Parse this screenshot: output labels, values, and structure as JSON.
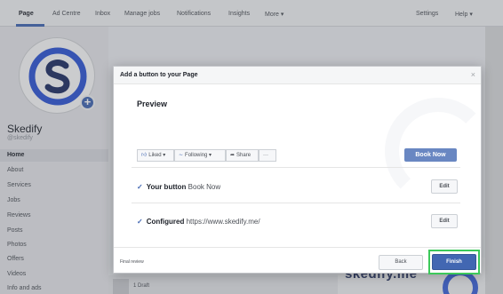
{
  "topnav": {
    "tabs": [
      {
        "label": "Page"
      },
      {
        "label": "Ad Centre"
      },
      {
        "label": "Inbox"
      },
      {
        "label": "Manage jobs"
      },
      {
        "label": "Notifications"
      },
      {
        "label": "Insights"
      },
      {
        "label": "More ▾"
      }
    ],
    "settings": "Settings",
    "help": "Help ▾"
  },
  "page": {
    "name": "Skedify",
    "handle": "@skedify"
  },
  "sidebar": {
    "items": [
      {
        "label": "Home"
      },
      {
        "label": "About"
      },
      {
        "label": "Services"
      },
      {
        "label": "Jobs"
      },
      {
        "label": "Reviews"
      },
      {
        "label": "Posts"
      },
      {
        "label": "Photos"
      },
      {
        "label": "Offers"
      },
      {
        "label": "Videos"
      },
      {
        "label": "Info and ads"
      }
    ]
  },
  "background": {
    "draft_label": "1 Draft",
    "banner_text": "skedify.me"
  },
  "dialog": {
    "title": "Add a button to your Page",
    "close": "×",
    "preview_title": "Preview",
    "preview_buttons": {
      "liked": "Liked ▾",
      "following": "Following ▾",
      "share": "Share",
      "more": "···"
    },
    "cta_label": "Book Now",
    "rows": [
      {
        "bold": "Your button",
        "rest": "Book Now",
        "edit": "Edit"
      },
      {
        "bold": "Configured",
        "rest": "https://www.skedify.me/",
        "edit": "Edit"
      }
    ],
    "footer": {
      "final_review": "Final review",
      "back": "Back",
      "finish": "Finish"
    }
  },
  "colors": {
    "brand_blue": "#4267b2",
    "highlight_green": "#3cc95a"
  }
}
